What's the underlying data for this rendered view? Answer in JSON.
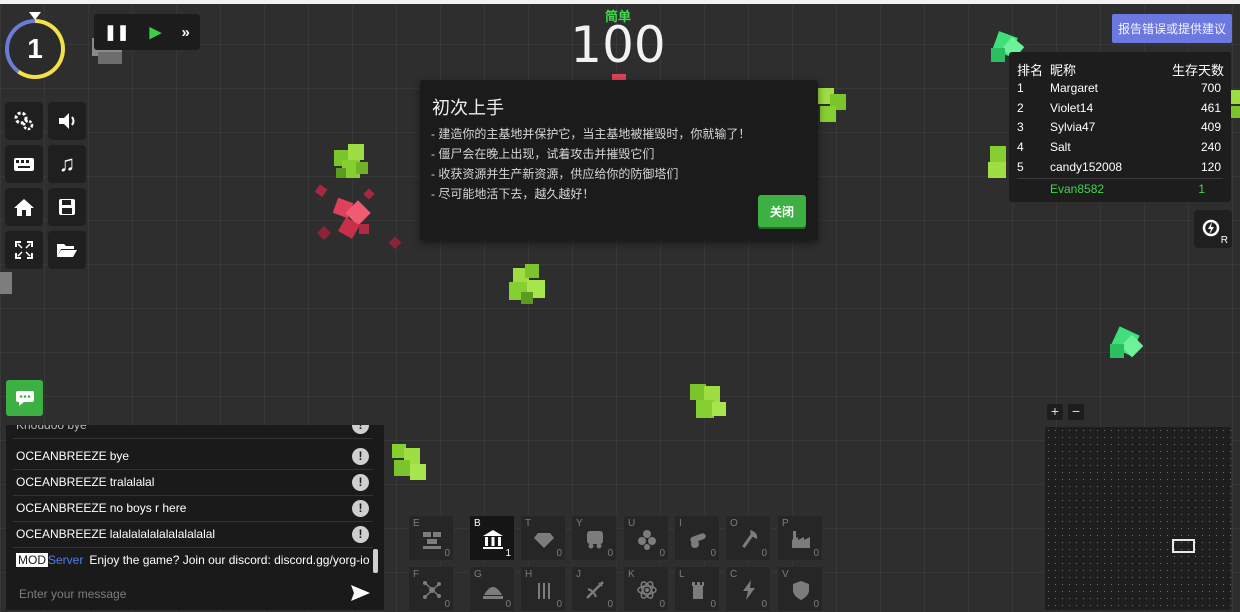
{
  "hud": {
    "day": "1",
    "difficulty": "简单",
    "score": "100",
    "speed_controls": [
      "pause-icon",
      "play-icon",
      "fast-forward-icon"
    ]
  },
  "tutorial": {
    "title": "初次上手",
    "lines": [
      "- 建造你的主基地并保护它，当主基地被摧毁时，你就输了！",
      "- 僵尸会在晚上出现，试着攻击并摧毁它们",
      "- 收获资源并生产新资源，供应给你的防御塔们",
      "- 尽可能地活下去，越久越好！"
    ],
    "close_label": "关闭"
  },
  "report_button": "报告错误或提供建议",
  "leaderboard": {
    "headers": [
      "排名",
      "昵称",
      "生存天数"
    ],
    "rows": [
      {
        "rank": "1",
        "name": "Margaret",
        "days": "700"
      },
      {
        "rank": "2",
        "name": "Violet14",
        "days": "461"
      },
      {
        "rank": "3",
        "name": "Sylvia47",
        "days": "409"
      },
      {
        "rank": "4",
        "name": "Salt",
        "days": "240"
      },
      {
        "rank": "5",
        "name": "candy152008",
        "days": "120"
      }
    ],
    "self": {
      "name": "Evan8582",
      "days": "1"
    },
    "self_color": "#3fd84e"
  },
  "power_button": {
    "key": "R"
  },
  "chat": {
    "messages": [
      {
        "name": "OCEANBREEZE",
        "text": "bye"
      },
      {
        "name": "OCEANBREEZE",
        "text": "tralalalal"
      },
      {
        "name": "OCEANBREEZE",
        "text": "no boys r here"
      },
      {
        "name": "OCEANBREEZE",
        "text": "lalalalalalalalalalalal"
      }
    ],
    "server_message": {
      "badge": "MOD",
      "name": "Server",
      "text": "Enjoy the game? Join our discord: discord.gg/yorg-io"
    },
    "input_placeholder": "Enter your message"
  },
  "buildings": {
    "row1": [
      {
        "key": "E",
        "count": "0",
        "icon": "wall-icon"
      },
      {
        "key": "B",
        "count": "1",
        "icon": "base-icon",
        "active": true
      },
      {
        "key": "T",
        "count": "0",
        "icon": "gem-icon"
      },
      {
        "key": "Y",
        "count": "0",
        "icon": "cart-icon"
      },
      {
        "key": "U",
        "count": "0",
        "icon": "stones-icon"
      },
      {
        "key": "I",
        "count": "0",
        "icon": "cannon-icon"
      },
      {
        "key": "O",
        "count": "0",
        "icon": "axe-icon"
      },
      {
        "key": "P",
        "count": "0",
        "icon": "factory-icon"
      }
    ],
    "row2": [
      {
        "key": "F",
        "count": "0",
        "icon": "network-icon"
      },
      {
        "key": "G",
        "count": "0",
        "icon": "dome-icon"
      },
      {
        "key": "H",
        "count": "0",
        "icon": "spikes-icon"
      },
      {
        "key": "J",
        "count": "0",
        "icon": "crossbow-icon"
      },
      {
        "key": "K",
        "count": "0",
        "icon": "atom-icon"
      },
      {
        "key": "L",
        "count": "0",
        "icon": "tower-icon"
      },
      {
        "key": "C",
        "count": "0",
        "icon": "lightning-icon"
      },
      {
        "key": "V",
        "count": "0",
        "icon": "shield-icon"
      }
    ]
  },
  "colors": {
    "accent_green": "#3cb043",
    "report_purple": "#6b78df",
    "crystal_green": "#3fe07a",
    "crystal_red": "#e0405a",
    "bush_green": "#8fd43a"
  }
}
